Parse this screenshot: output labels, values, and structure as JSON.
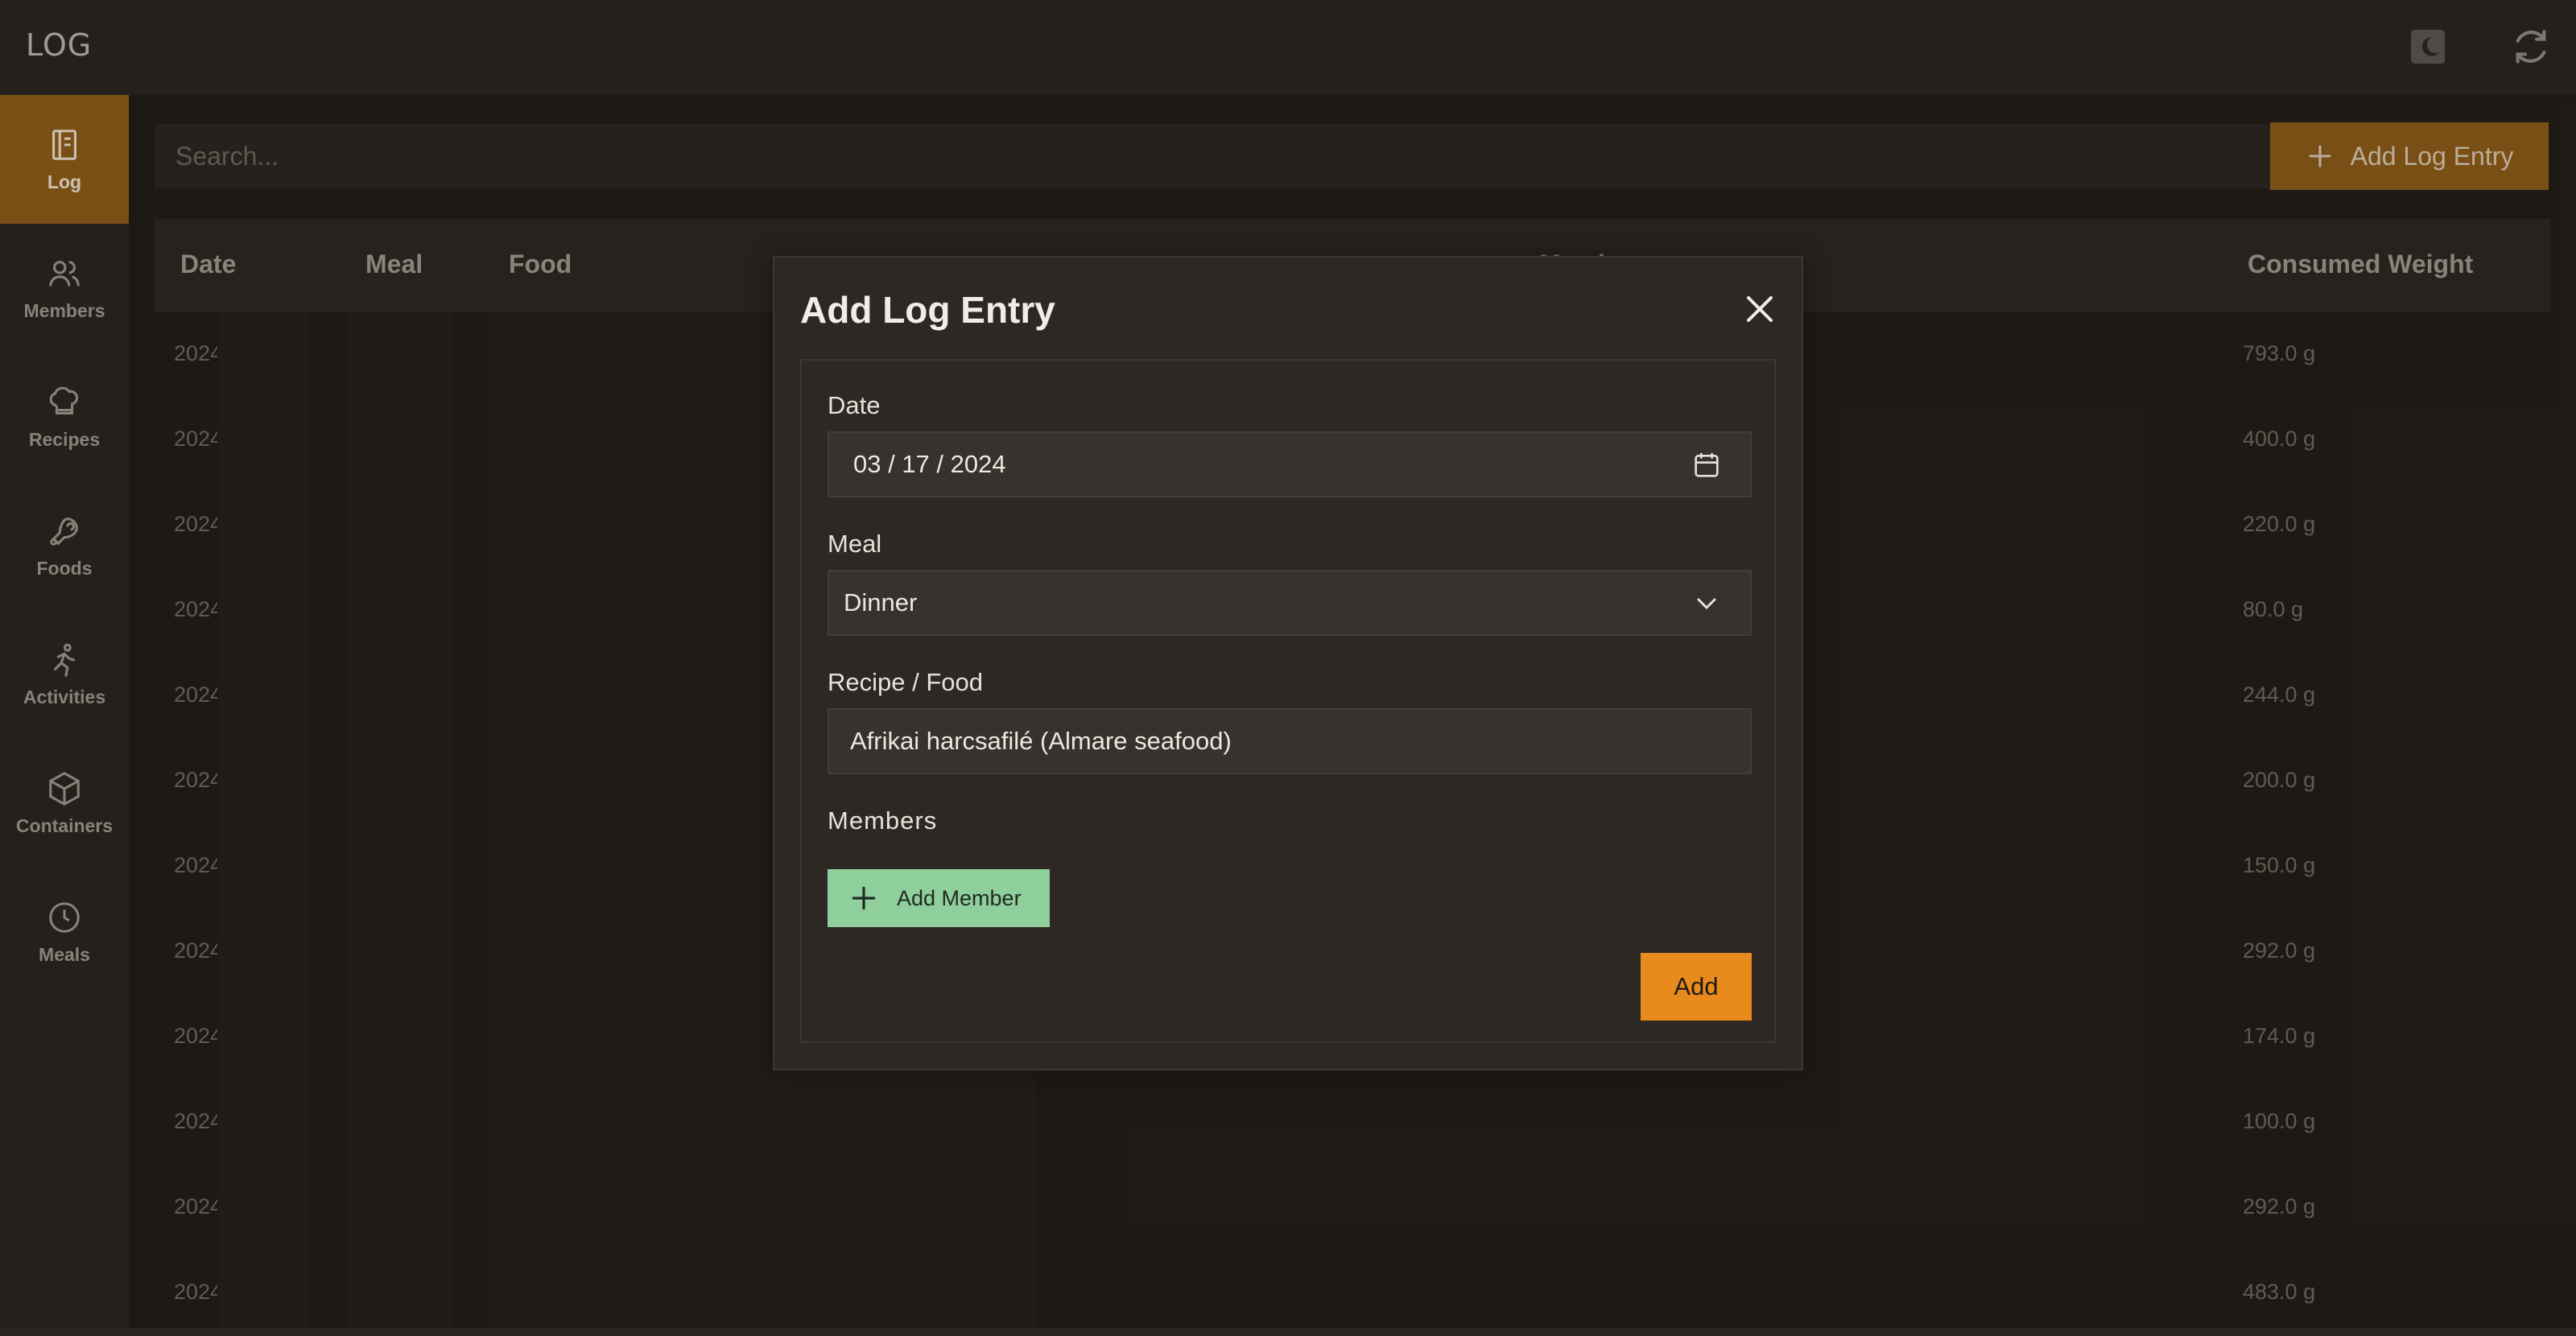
{
  "app": {
    "title": "LOG"
  },
  "topbar": {
    "theme_icon": "moon-icon",
    "refresh_icon": "refresh-icon"
  },
  "sidebar": {
    "items": [
      {
        "label": "Log",
        "icon": "notebook-icon",
        "active": true
      },
      {
        "label": "Members",
        "icon": "users-icon"
      },
      {
        "label": "Recipes",
        "icon": "chef-hat-icon"
      },
      {
        "label": "Foods",
        "icon": "meat-icon"
      },
      {
        "label": "Activities",
        "icon": "running-icon"
      },
      {
        "label": "Containers",
        "icon": "box-icon"
      },
      {
        "label": "Meals",
        "icon": "clock-icon"
      }
    ]
  },
  "toolbar": {
    "search_placeholder": "Search...",
    "add_entry_label": "Add Log Entry"
  },
  "table": {
    "columns": [
      "Date",
      "Meal",
      "Food",
      "Member",
      "Consumed Weight"
    ],
    "rows": [
      {
        "date": "2024",
        "weight": "793.0 g"
      },
      {
        "date": "2024",
        "weight": "400.0 g"
      },
      {
        "date": "2024",
        "weight": "220.0 g"
      },
      {
        "date": "2024",
        "weight": "80.0 g"
      },
      {
        "date": "2024",
        "weight": "244.0 g"
      },
      {
        "date": "2024",
        "weight": "200.0 g"
      },
      {
        "date": "2024",
        "weight": "150.0 g"
      },
      {
        "date": "2024",
        "weight": "292.0 g"
      },
      {
        "date": "2024",
        "weight": "174.0 g"
      },
      {
        "date": "2024",
        "weight": "100.0 g"
      },
      {
        "date": "2024",
        "weight": "292.0 g"
      },
      {
        "date": "2024",
        "weight": "483.0 g"
      }
    ]
  },
  "modal": {
    "title": "Add Log Entry",
    "date_label": "Date",
    "date_value": "03 / 17 / 2024",
    "meal_label": "Meal",
    "meal_value": "Dinner",
    "food_label": "Recipe / Food",
    "food_value": "Afrikai harcsafilé (Almare seafood)",
    "members_label": "Members",
    "add_member_label": "Add Member",
    "submit_label": "Add"
  },
  "colors": {
    "accent": "#e98a1c",
    "accent_dim": "#8a5a19",
    "member_button": "#8fcf9c"
  }
}
